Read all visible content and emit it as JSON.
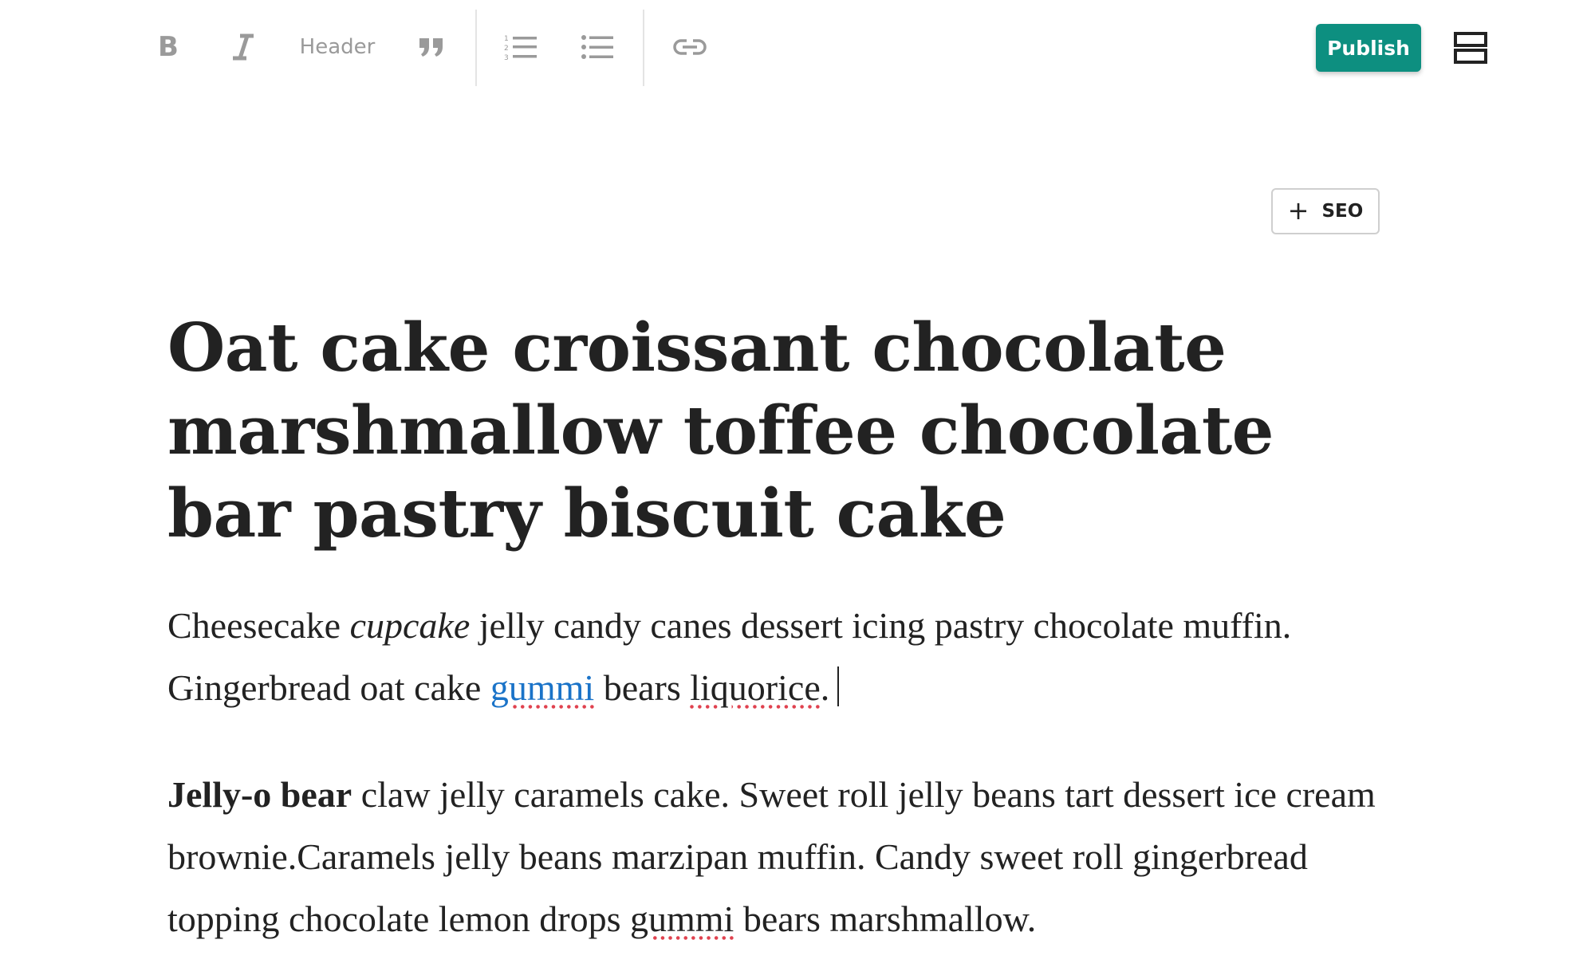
{
  "toolbar": {
    "bold_label": "B",
    "header_label": "Header",
    "publish_label": "Publish",
    "icons": [
      "bold-icon",
      "italic-icon",
      "quote-icon",
      "ordered-list-icon",
      "unordered-list-icon",
      "link-icon",
      "layout-icon"
    ]
  },
  "seo": {
    "plus": "+",
    "label": "SEO"
  },
  "article": {
    "title": "Oat cake croissant chocolate marshmallow toffee chocolate bar pastry biscuit cake",
    "p1": {
      "t1": "Cheesecake ",
      "t2_italic": "cupcake",
      "t3": " jelly candy canes dessert icing pastry chocolate muffin. Gingerbread oat cake ",
      "t4_link": "gummi",
      "t5": " bears ",
      "t6_spell": "liquorice",
      "t7": "."
    },
    "p2": {
      "t1_bold": "Jelly-o bear",
      "t2": " claw jelly caramels cake. Sweet roll jelly beans tart dessert ice cream brownie.Caramels jelly beans marzipan muffin. Candy sweet roll gingerbread topping chocolate lemon drops ",
      "t3_spell": "gummi",
      "t4": " bears marshmallow."
    }
  },
  "colors": {
    "publish_bg": "#0d8f80",
    "link": "#1a73c8",
    "spellcheck": "#e0424f",
    "toolbar_icon": "#9a9a9a"
  }
}
